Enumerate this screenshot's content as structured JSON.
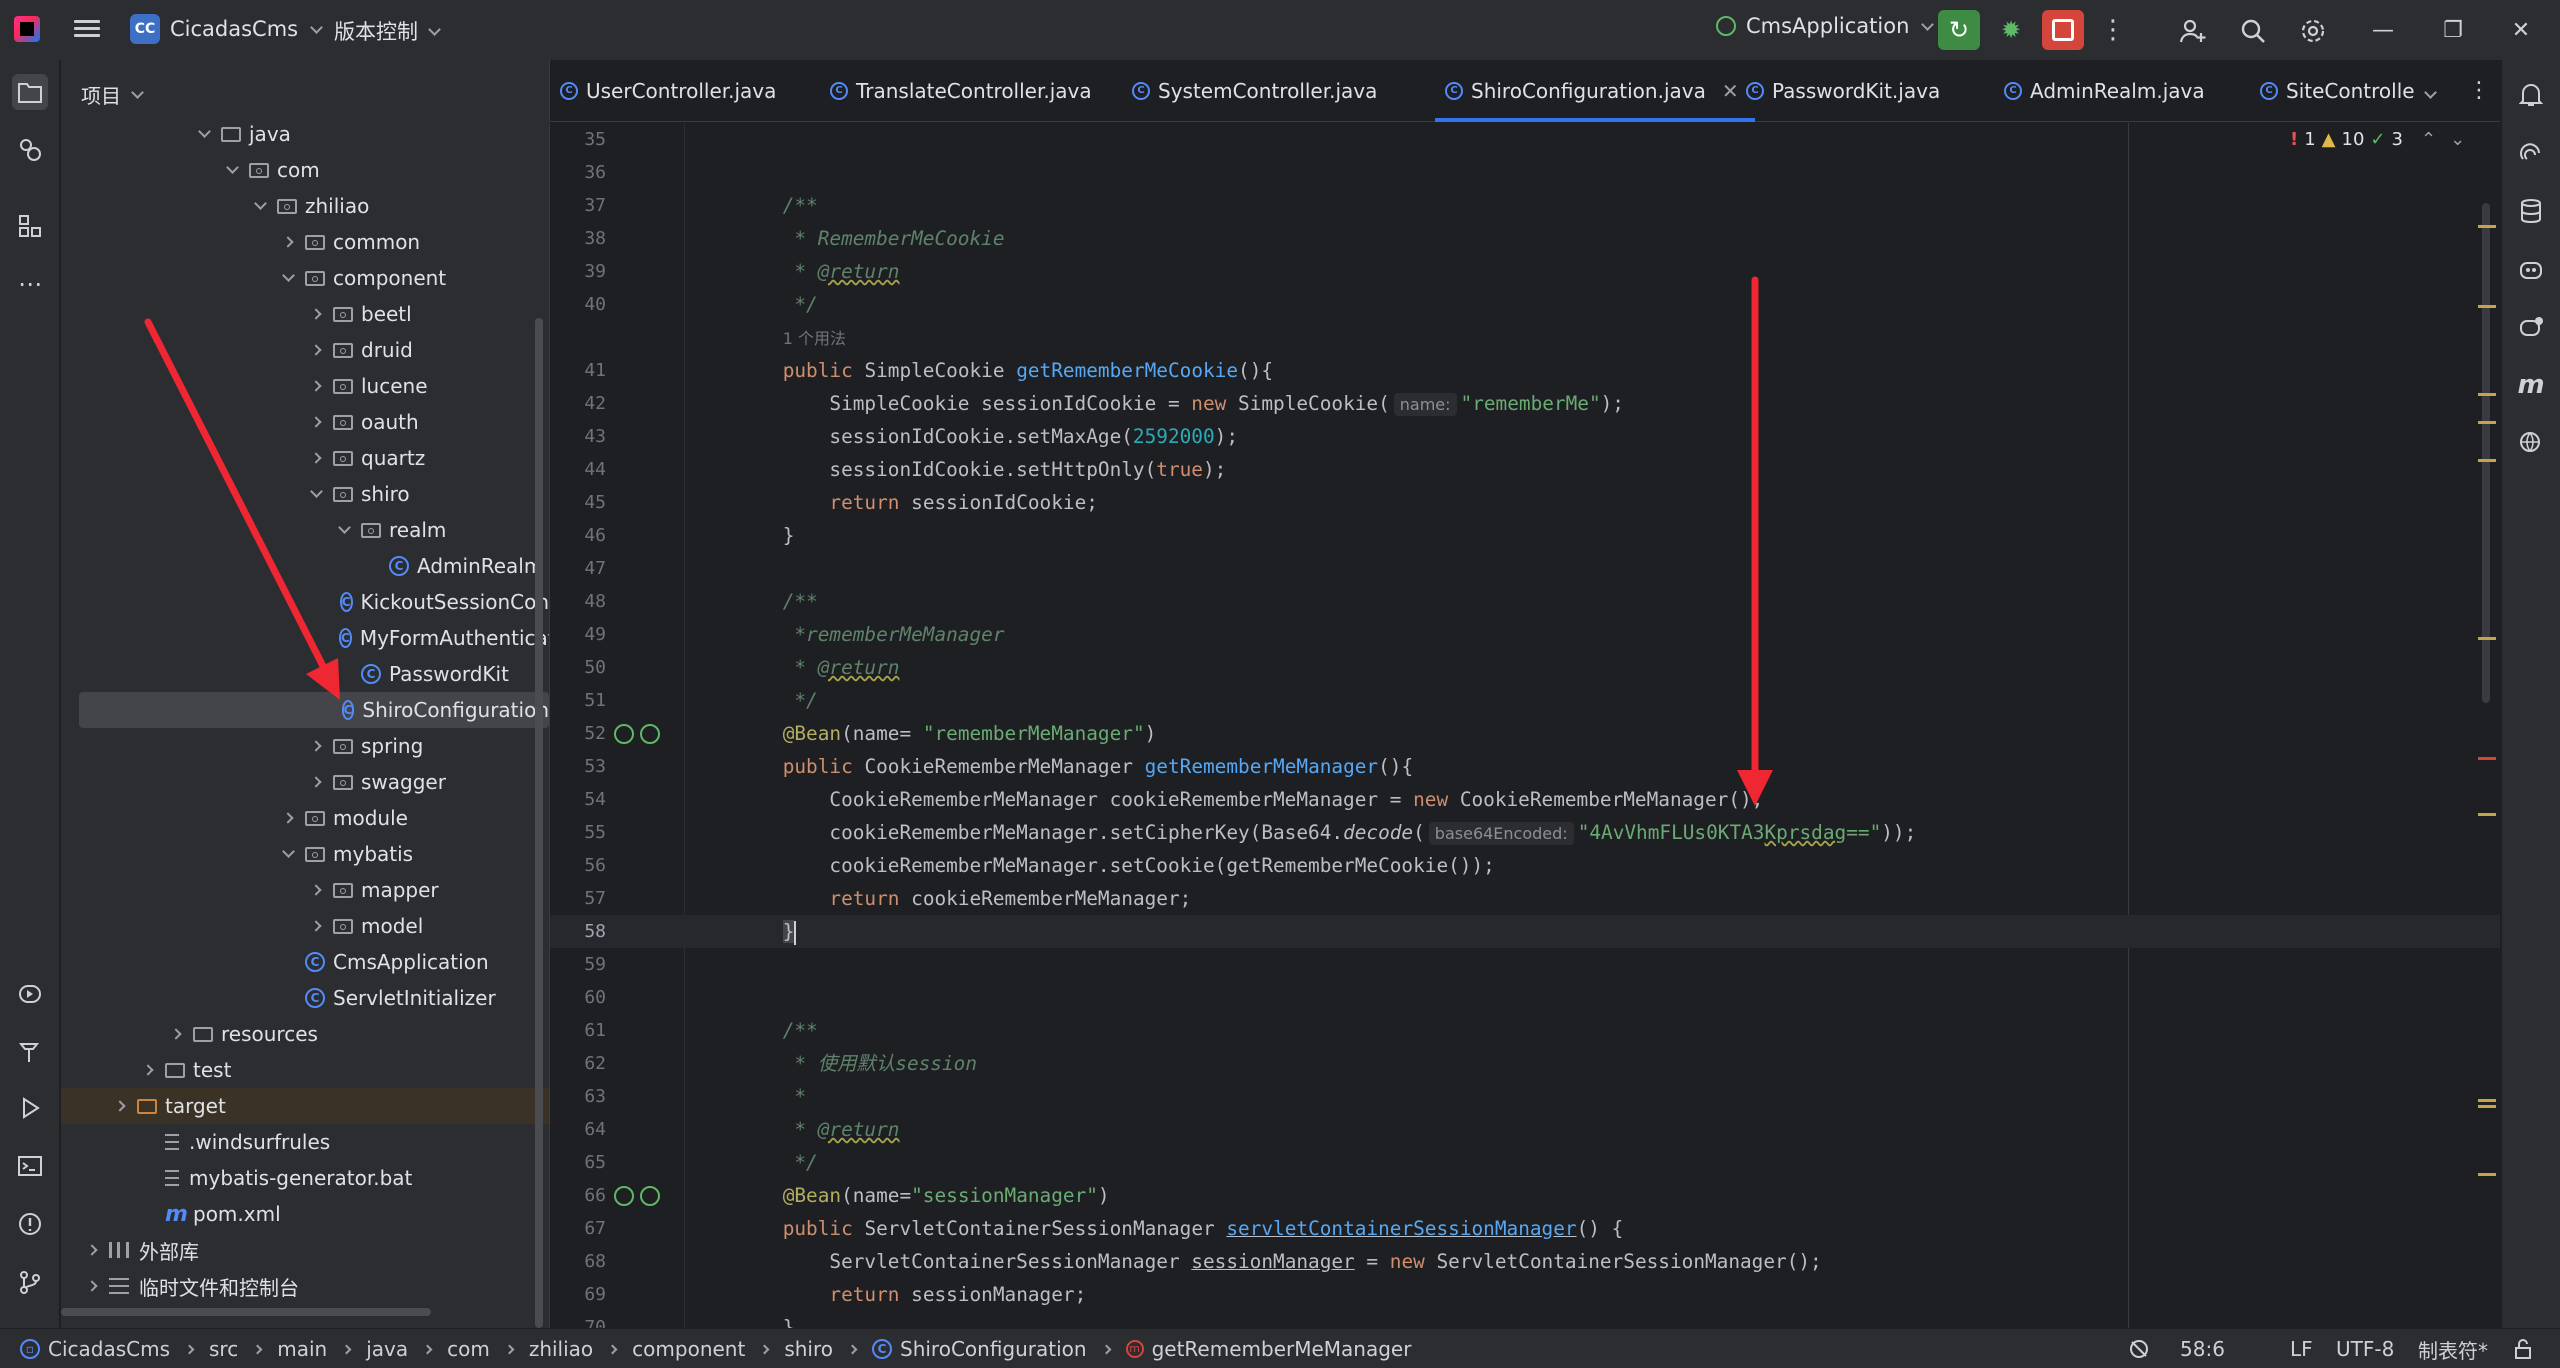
{
  "titlebar": {
    "project_badge": "CC",
    "project_name": "CicadasCms",
    "vcs_label": "版本控制",
    "run_config": "CmsApplication",
    "icons": [
      "main-menu-icon",
      "rerun-icon",
      "debug-icon",
      "stop-icon",
      "more-icon",
      "add-user-icon",
      "search-icon",
      "settings-icon",
      "minimize-icon",
      "restore-icon",
      "close-icon"
    ],
    "minimize": "—",
    "restore": "❐",
    "close": "✕"
  },
  "panel": {
    "title": "项目",
    "tree": [
      {
        "label": "java",
        "indent": 4,
        "type": "folder",
        "arrow": "open"
      },
      {
        "label": "com",
        "indent": 5,
        "type": "pkg",
        "arrow": "open"
      },
      {
        "label": "zhiliao",
        "indent": 6,
        "type": "pkg",
        "arrow": "open"
      },
      {
        "label": "common",
        "indent": 7,
        "type": "pkg",
        "arrow": "closed"
      },
      {
        "label": "component",
        "indent": 7,
        "type": "pkg",
        "arrow": "open"
      },
      {
        "label": "beetl",
        "indent": 8,
        "type": "pkg",
        "arrow": "closed"
      },
      {
        "label": "druid",
        "indent": 8,
        "type": "pkg",
        "arrow": "closed"
      },
      {
        "label": "lucene",
        "indent": 8,
        "type": "pkg",
        "arrow": "closed"
      },
      {
        "label": "oauth",
        "indent": 8,
        "type": "pkg",
        "arrow": "closed"
      },
      {
        "label": "quartz",
        "indent": 8,
        "type": "pkg",
        "arrow": "closed"
      },
      {
        "label": "shiro",
        "indent": 8,
        "type": "pkg",
        "arrow": "open"
      },
      {
        "label": "realm",
        "indent": 9,
        "type": "pkg",
        "arrow": "open"
      },
      {
        "label": "AdminRealm",
        "indent": 10,
        "type": "class",
        "arrow": "none"
      },
      {
        "label": "KickoutSessionCon",
        "indent": 9,
        "type": "class",
        "arrow": "none"
      },
      {
        "label": "MyFormAuthenticat",
        "indent": 9,
        "type": "class",
        "arrow": "none"
      },
      {
        "label": "PasswordKit",
        "indent": 9,
        "type": "class",
        "arrow": "none"
      },
      {
        "label": "ShiroConfiguration",
        "indent": 9,
        "type": "class",
        "arrow": "none",
        "selected": true
      },
      {
        "label": "spring",
        "indent": 8,
        "type": "pkg",
        "arrow": "closed"
      },
      {
        "label": "swagger",
        "indent": 8,
        "type": "pkg",
        "arrow": "closed"
      },
      {
        "label": "module",
        "indent": 7,
        "type": "pkg",
        "arrow": "closed"
      },
      {
        "label": "mybatis",
        "indent": 7,
        "type": "pkg",
        "arrow": "open"
      },
      {
        "label": "mapper",
        "indent": 8,
        "type": "pkg",
        "arrow": "closed"
      },
      {
        "label": "model",
        "indent": 8,
        "type": "pkg",
        "arrow": "closed"
      },
      {
        "label": "CmsApplication",
        "indent": 7,
        "type": "class",
        "arrow": "none"
      },
      {
        "label": "ServletInitializer",
        "indent": 7,
        "type": "class",
        "arrow": "none"
      },
      {
        "label": "resources",
        "indent": 3,
        "type": "folder",
        "arrow": "closed"
      },
      {
        "label": "test",
        "indent": 2,
        "type": "folder",
        "arrow": "closed"
      },
      {
        "label": "target",
        "indent": 1,
        "type": "folder-orange",
        "arrow": "closed",
        "highlight": true
      },
      {
        "label": ".windsurfrules",
        "indent": 2,
        "type": "file",
        "arrow": "none"
      },
      {
        "label": "mybatis-generator.bat",
        "indent": 2,
        "type": "file",
        "arrow": "none"
      },
      {
        "label": "pom.xml",
        "indent": 2,
        "type": "maven",
        "arrow": "none"
      },
      {
        "label": "外部库",
        "indent": 0,
        "type": "lib",
        "arrow": "closed"
      },
      {
        "label": "临时文件和控制台",
        "indent": 0,
        "type": "scratch",
        "arrow": "closed"
      }
    ]
  },
  "tabs": [
    {
      "label": "UserController.java"
    },
    {
      "label": "TranslateController.java"
    },
    {
      "label": "SystemController.java"
    },
    {
      "label": "ShiroConfiguration.java",
      "active": true,
      "close": "✕"
    },
    {
      "label": "PasswordKit.java"
    },
    {
      "label": "AdminRealm.java"
    },
    {
      "label": "SiteControlle"
    }
  ],
  "editor": {
    "inspection": {
      "errors": "1",
      "warnings": "10",
      "weak": "3"
    },
    "lines": [
      {
        "n": "35",
        "t": []
      },
      {
        "n": "36",
        "t": []
      },
      {
        "n": "37",
        "t": [
          [
            "    ",
            ""
          ],
          [
            "/**",
            "cm"
          ]
        ]
      },
      {
        "n": "38",
        "t": [
          [
            "     * RememberMeCookie",
            "cm"
          ]
        ]
      },
      {
        "n": "39",
        "t": [
          [
            "     * ",
            "cm"
          ],
          [
            "@return",
            "tag"
          ]
        ]
      },
      {
        "n": "40",
        "t": [
          [
            "     */",
            "cm"
          ]
        ]
      },
      {
        "n": "",
        "t": [
          [
            "    ",
            ""
          ],
          [
            "1 个用法",
            "usage"
          ]
        ]
      },
      {
        "n": "41",
        "t": [
          [
            "    ",
            ""
          ],
          [
            "public ",
            "kw"
          ],
          [
            "SimpleCookie ",
            ""
          ],
          [
            "getRememberMeCookie",
            "fn"
          ],
          [
            "(){",
            ""
          ]
        ]
      },
      {
        "n": "42",
        "t": [
          [
            "        SimpleCookie sessionIdCookie = ",
            ""
          ],
          [
            "new ",
            "kw"
          ],
          [
            "SimpleCookie(",
            ""
          ],
          [
            "name:",
            "hint"
          ],
          [
            "\"rememberMe\"",
            "str"
          ],
          [
            ");",
            ""
          ]
        ]
      },
      {
        "n": "43",
        "t": [
          [
            "        sessionIdCookie.setMaxAge(",
            ""
          ],
          [
            "2592000",
            "num"
          ],
          [
            ");",
            ""
          ]
        ]
      },
      {
        "n": "44",
        "t": [
          [
            "        sessionIdCookie.setHttpOnly(",
            ""
          ],
          [
            "true",
            "kw"
          ],
          [
            ");",
            ""
          ]
        ]
      },
      {
        "n": "45",
        "t": [
          [
            "        ",
            ""
          ],
          [
            "return ",
            "kw"
          ],
          [
            "sessionIdCookie;",
            ""
          ]
        ]
      },
      {
        "n": "46",
        "t": [
          [
            "    }",
            ""
          ]
        ]
      },
      {
        "n": "47",
        "t": []
      },
      {
        "n": "48",
        "t": [
          [
            "    ",
            ""
          ],
          [
            "/**",
            "cm"
          ]
        ]
      },
      {
        "n": "49",
        "t": [
          [
            "     *rememberMeManager",
            "cm"
          ]
        ]
      },
      {
        "n": "50",
        "t": [
          [
            "     * ",
            "cm"
          ],
          [
            "@return",
            "tag"
          ]
        ]
      },
      {
        "n": "51",
        "t": [
          [
            "     */",
            "cm"
          ]
        ]
      },
      {
        "n": "52",
        "t": [
          [
            "    ",
            ""
          ],
          [
            "@Bean",
            "ann"
          ],
          [
            "(name= ",
            ""
          ],
          [
            "\"rememberMeManager\"",
            "str"
          ],
          [
            ")",
            ""
          ]
        ],
        "gutter": true
      },
      {
        "n": "53",
        "t": [
          [
            "    ",
            ""
          ],
          [
            "public ",
            "kw"
          ],
          [
            "CookieRememberMeManager ",
            ""
          ],
          [
            "getRememberMeManager",
            "fn"
          ],
          [
            "(){",
            ""
          ]
        ]
      },
      {
        "n": "54",
        "t": [
          [
            "        CookieRememberMeManager cookieRememberMeManager = ",
            ""
          ],
          [
            "new ",
            "kw"
          ],
          [
            "CookieRememberMeManager();",
            ""
          ]
        ]
      },
      {
        "n": "55",
        "t": [
          [
            "        cookieRememberMeManager.setCipherKey(Base64.",
            ""
          ],
          [
            "decode",
            "static"
          ],
          [
            "(",
            ""
          ],
          [
            "base64Encoded:",
            "hint"
          ],
          [
            "\"4AvVhmFLUs0KTA3",
            "str"
          ],
          [
            "Kprsdag",
            "strwarn"
          ],
          [
            "==\"",
            "str"
          ],
          [
            "));",
            ""
          ]
        ]
      },
      {
        "n": "56",
        "t": [
          [
            "        cookieRememberMeManager.setCookie(getRememberMeCookie());",
            ""
          ]
        ]
      },
      {
        "n": "57",
        "t": [
          [
            "        ",
            ""
          ],
          [
            "return ",
            "kw"
          ],
          [
            "cookieRememberMeManager;",
            ""
          ]
        ]
      },
      {
        "n": "58",
        "t": [
          [
            "    ",
            ""
          ],
          [
            "}",
            "brace"
          ],
          [
            "",
            "caret"
          ]
        ],
        "current": true
      },
      {
        "n": "59",
        "t": []
      },
      {
        "n": "60",
        "t": []
      },
      {
        "n": "61",
        "t": [
          [
            "    ",
            ""
          ],
          [
            "/**",
            "cm"
          ]
        ]
      },
      {
        "n": "62",
        "t": [
          [
            "     * 使用默认session",
            "cm"
          ]
        ]
      },
      {
        "n": "63",
        "t": [
          [
            "     *",
            "cm"
          ]
        ]
      },
      {
        "n": "64",
        "t": [
          [
            "     * ",
            "cm"
          ],
          [
            "@return",
            "tag"
          ]
        ]
      },
      {
        "n": "65",
        "t": [
          [
            "     */",
            "cm"
          ]
        ]
      },
      {
        "n": "66",
        "t": [
          [
            "    ",
            ""
          ],
          [
            "@Bean",
            "ann"
          ],
          [
            "(name=",
            ""
          ],
          [
            "\"sessionManager\"",
            "str"
          ],
          [
            ")",
            ""
          ]
        ],
        "gutter": true
      },
      {
        "n": "67",
        "t": [
          [
            "    ",
            ""
          ],
          [
            "public ",
            "kw"
          ],
          [
            "ServletContainerSessionManager ",
            ""
          ],
          [
            "servletContainerSessionManager",
            "fnul"
          ],
          [
            "() {",
            ""
          ]
        ]
      },
      {
        "n": "68",
        "t": [
          [
            "        ServletContainerSessionManager ",
            ""
          ],
          [
            "sessionManager",
            "ul"
          ],
          [
            " = ",
            ""
          ],
          [
            "new ",
            "kw"
          ],
          [
            "ServletContainerSessionManager();",
            ""
          ]
        ]
      },
      {
        "n": "69",
        "t": [
          [
            "        ",
            ""
          ],
          [
            "return ",
            "kw"
          ],
          [
            "sessionManager;",
            ""
          ]
        ]
      },
      {
        "n": "70",
        "t": [
          [
            "    }",
            ""
          ]
        ]
      }
    ]
  },
  "status": {
    "crumbs": [
      "CicadasCms",
      "src",
      "main",
      "java",
      "com",
      "zhiliao",
      "component",
      "shiro",
      "ShiroConfiguration",
      "getRememberMeManager"
    ],
    "position": "58:6",
    "line_sep": "LF",
    "encoding": "UTF-8",
    "indent": "制表符*"
  },
  "colors": {
    "accent": "#3574f0",
    "arrow": "#ee2733"
  }
}
